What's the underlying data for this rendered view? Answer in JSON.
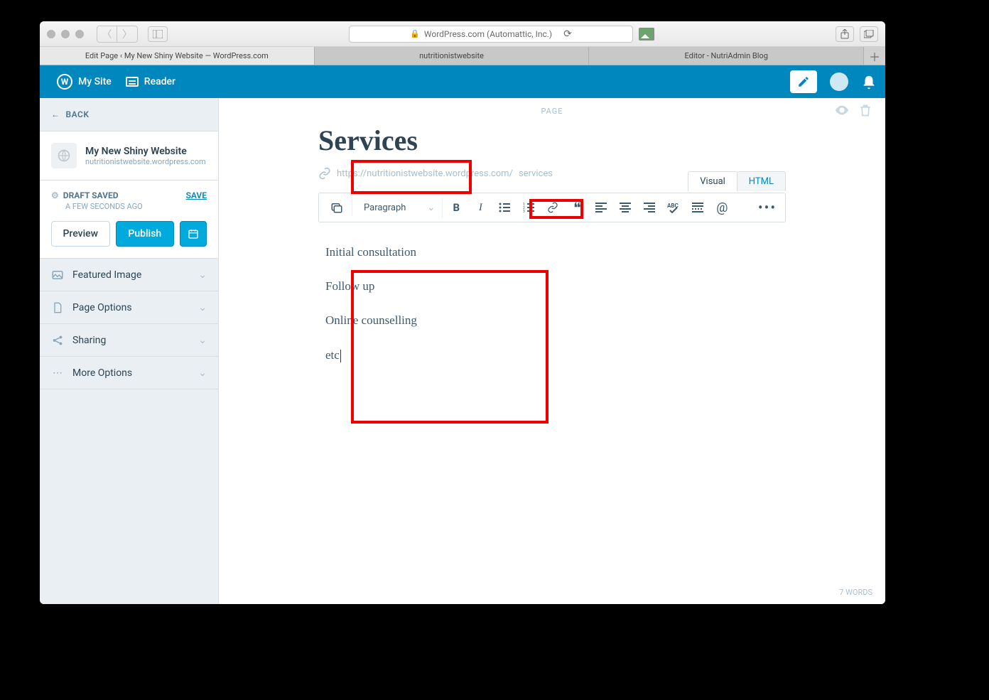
{
  "browser": {
    "address_host": "WordPress.com (Automattic, Inc.)",
    "tabs": [
      "Edit Page ‹ My New Shiny Website — WordPress.com",
      "nutritionistwebsite",
      "Editor - NutriAdmin Blog"
    ]
  },
  "masterbar": {
    "my_site": "My Site",
    "reader": "Reader"
  },
  "sidebar": {
    "back": "BACK",
    "site_name": "My New Shiny Website",
    "site_url": "nutritionistwebsite.wordpress.com",
    "draft_saved": "DRAFT SAVED",
    "save": "SAVE",
    "timeago": "A FEW SECONDS AGO",
    "preview": "Preview",
    "publish": "Publish",
    "accordion": {
      "featured_image": "Featured Image",
      "page_options": "Page Options",
      "sharing": "Sharing",
      "more_options": "More Options"
    }
  },
  "editor": {
    "page_type": "PAGE",
    "title": "Services",
    "permalink_base": "https://nutritionistwebsite.wordpress.com/",
    "permalink_slug": "services",
    "tab_visual": "Visual",
    "tab_html": "HTML",
    "format_label": "Paragraph",
    "content": [
      "Initial consultation",
      "Follow up",
      "Online counselling",
      "etc"
    ],
    "word_count": "7 WORDS"
  }
}
